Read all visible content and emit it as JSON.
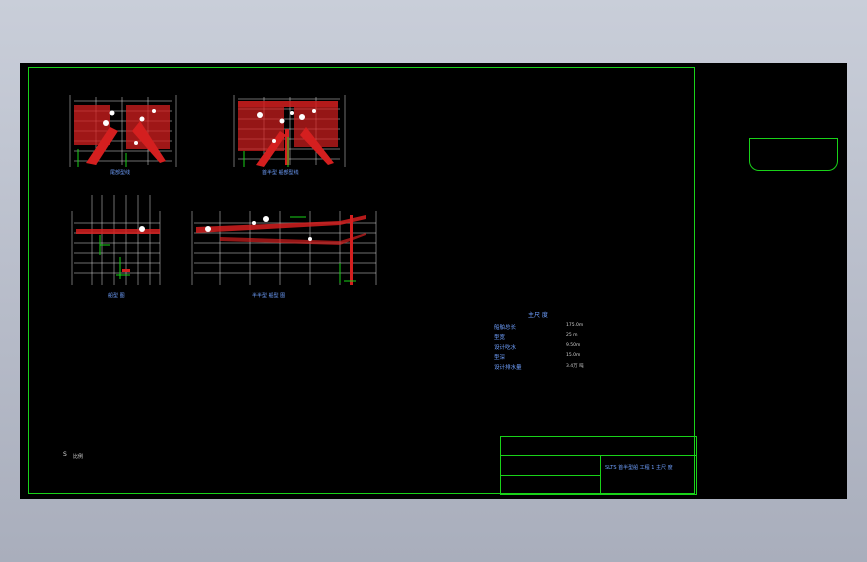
{
  "drawings": {
    "stern_lines": "尾部型线",
    "stern_half_lines": "首半型 船部型线",
    "side_view": "船型 图",
    "half_side_view": "半半型 船型 图"
  },
  "spec_table": {
    "title": "主尺 度",
    "rows": [
      {
        "label": "船舶总长",
        "value": "175.0m"
      },
      {
        "label": "型宽",
        "value": "25 m"
      },
      {
        "label": "设计吃水",
        "value": "9.50m"
      },
      {
        "label": "型深",
        "value": "15.0m"
      },
      {
        "label": "设计排水量",
        "value": "3.4万 吨"
      }
    ]
  },
  "title_block": {
    "drawing_title": "SLTS 首半型船 工程 1 主尺 度"
  },
  "scale_note": {
    "mark": "S",
    "text": "比例"
  },
  "colors": {
    "background": "#000000",
    "frame": "#19d219",
    "hatch": "#d41f1f",
    "label": "#6fa0ff",
    "viewport": "#c0c5d2"
  }
}
